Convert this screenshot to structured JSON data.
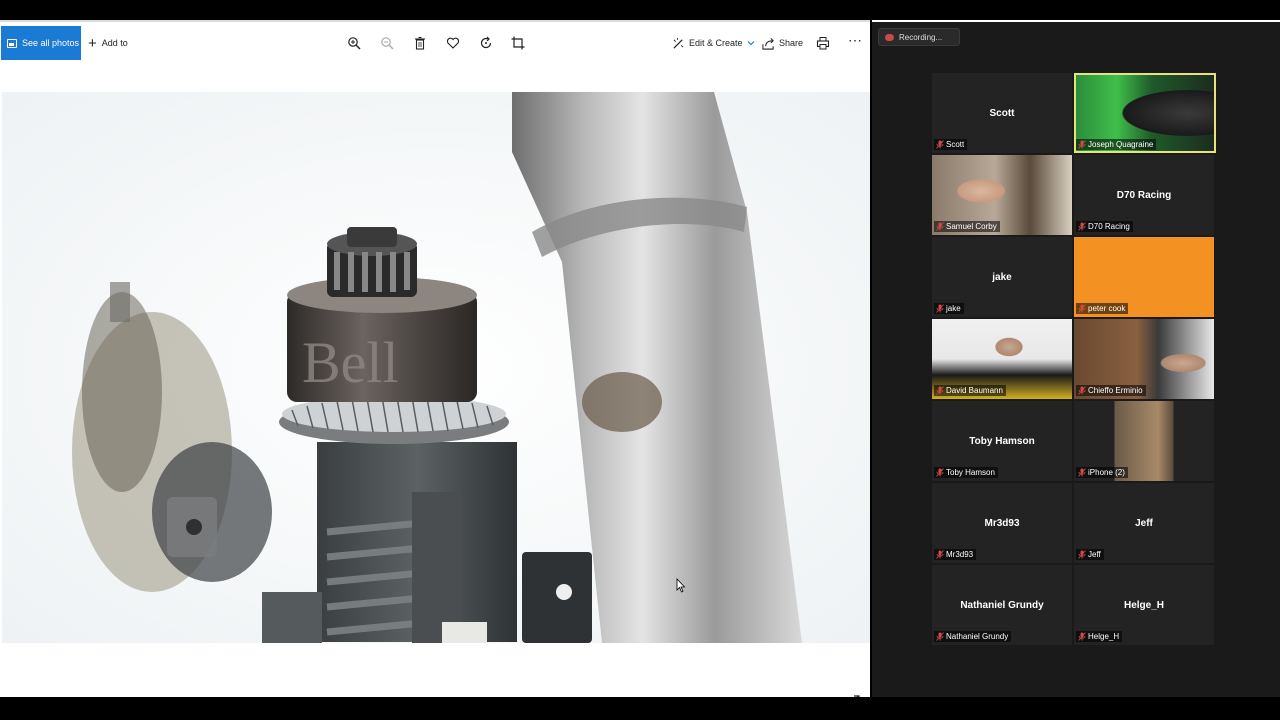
{
  "photos_app": {
    "toolbar": {
      "see_all_photos": "See all photos",
      "add_to": "Add to",
      "edit_create": "Edit & Create",
      "share": "Share",
      "more": "⋯"
    },
    "icons": [
      "zoom-in-icon",
      "zoom-out-icon",
      "delete-icon",
      "favorite-icon",
      "rotate-icon",
      "crop-icon",
      "print-icon",
      "expand-icon"
    ],
    "photo_engraving": "Bell"
  },
  "zoom": {
    "recording_label": "Recording...",
    "participants": [
      {
        "label": "Scott",
        "center": "Scott",
        "video": false
      },
      {
        "label": "Joseph Quagraine",
        "center": "",
        "video": true,
        "active": true
      },
      {
        "label": "Samuel Corby",
        "center": "",
        "video": true
      },
      {
        "label": "D70 Racing",
        "center": "D70 Racing",
        "video": false
      },
      {
        "label": "jake",
        "center": "jake",
        "video": false
      },
      {
        "label": "peter cook",
        "center": "",
        "video": true
      },
      {
        "label": "David Baumann",
        "center": "",
        "video": true
      },
      {
        "label": "Chieffo Erminio",
        "center": "",
        "video": true
      },
      {
        "label": "Toby Hamson",
        "center": "Toby Hamson",
        "video": false
      },
      {
        "label": "iPhone (2)",
        "center": "",
        "video": true
      },
      {
        "label": "Mr3d93",
        "center": "Mr3d93",
        "video": false
      },
      {
        "label": "Jeff",
        "center": "Jeff",
        "video": false
      },
      {
        "label": "Nathaniel Grundy",
        "center": "Nathaniel Grundy",
        "video": false
      },
      {
        "label": "Helge_H",
        "center": "Helge_H",
        "video": false
      }
    ],
    "colors": {
      "active_border": "#e8e27a",
      "muted_mic": "#d24b4b",
      "orange_tile": "#f39123"
    }
  }
}
